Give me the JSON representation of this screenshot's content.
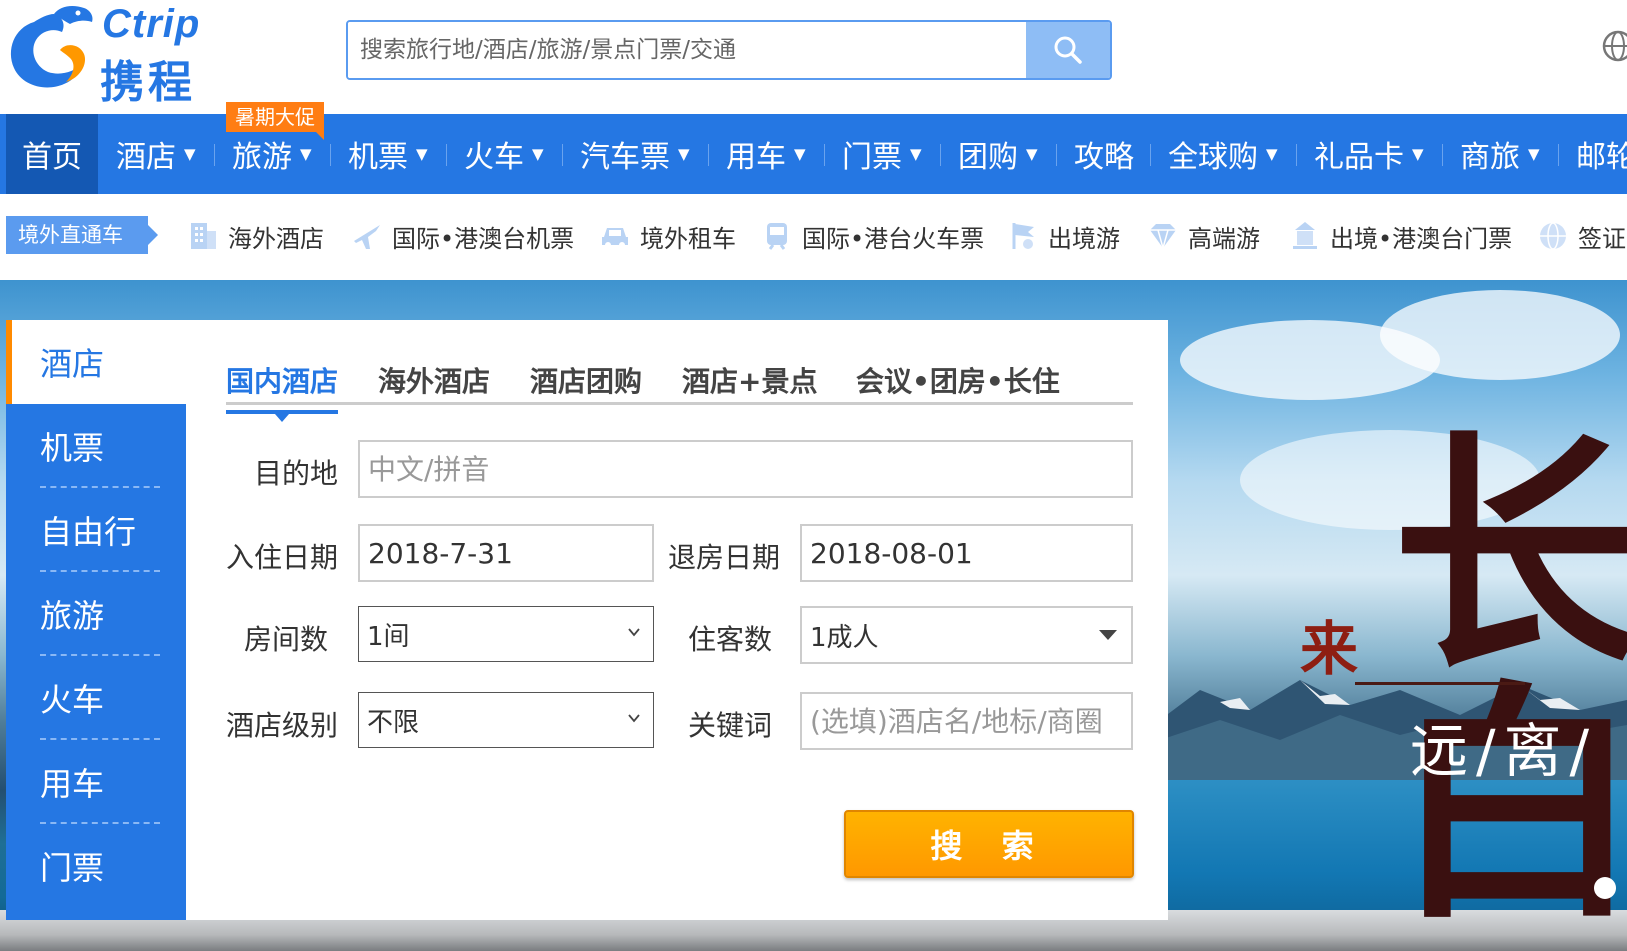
{
  "brand": {
    "name_en": "Ctrip",
    "name_cn": "携程"
  },
  "search": {
    "placeholder": "搜索旅行地/酒店/旅游/景点门票/交通"
  },
  "mainnav": {
    "promo_badge": "暑期大促",
    "items": [
      {
        "label": "首页"
      },
      {
        "label": "酒店"
      },
      {
        "label": "旅游"
      },
      {
        "label": "机票"
      },
      {
        "label": "火车"
      },
      {
        "label": "汽车票"
      },
      {
        "label": "用车"
      },
      {
        "label": "门票"
      },
      {
        "label": "团购"
      },
      {
        "label": "攻略"
      },
      {
        "label": "全球购"
      },
      {
        "label": "礼品卡"
      },
      {
        "label": "商旅"
      },
      {
        "label": "邮轮"
      }
    ]
  },
  "subnav": {
    "tag": "境外直通车",
    "items": [
      {
        "label": "海外酒店",
        "icon": "building-icon"
      },
      {
        "label": "国际•港澳台机票",
        "icon": "plane-icon"
      },
      {
        "label": "境外租车",
        "icon": "car-icon"
      },
      {
        "label": "国际•港台火车票",
        "icon": "train-icon"
      },
      {
        "label": "出境游",
        "icon": "flag-icon"
      },
      {
        "label": "高端游",
        "icon": "diamond-icon"
      },
      {
        "label": "出境•港澳台门票",
        "icon": "ticket-icon"
      },
      {
        "label": "签证",
        "icon": "globe-icon"
      }
    ]
  },
  "side": {
    "items": [
      {
        "label": "酒店"
      },
      {
        "label": "机票"
      },
      {
        "label": "自由行"
      },
      {
        "label": "旅游"
      },
      {
        "label": "火车"
      },
      {
        "label": "用车"
      },
      {
        "label": "门票"
      }
    ]
  },
  "hotel": {
    "tabs": [
      {
        "label": "国内酒店"
      },
      {
        "label": "海外酒店"
      },
      {
        "label": "酒店团购"
      },
      {
        "label": "酒店+景点"
      },
      {
        "label": "会议•团房•长住"
      }
    ],
    "destination_label": "目的地",
    "destination_placeholder": "中文/拼音",
    "checkin_label": "入住日期",
    "checkin_value": "2018-7-31",
    "checkout_label": "退房日期",
    "checkout_value": "2018-08-01",
    "rooms_label": "房间数",
    "rooms_value": "1间",
    "guests_label": "住客数",
    "guests_value": "1成人",
    "level_label": "酒店级别",
    "level_value": "不限",
    "keyword_label": "关键词",
    "keyword_placeholder": "(选填)酒店名/地标/商圈",
    "search_label": "搜 索"
  },
  "banner": {
    "lai": "来",
    "big": "长白",
    "sub": "远/离/"
  },
  "colors": {
    "primary": "#2577e3",
    "accent": "#ff9800",
    "promo": "#ff7d13"
  }
}
